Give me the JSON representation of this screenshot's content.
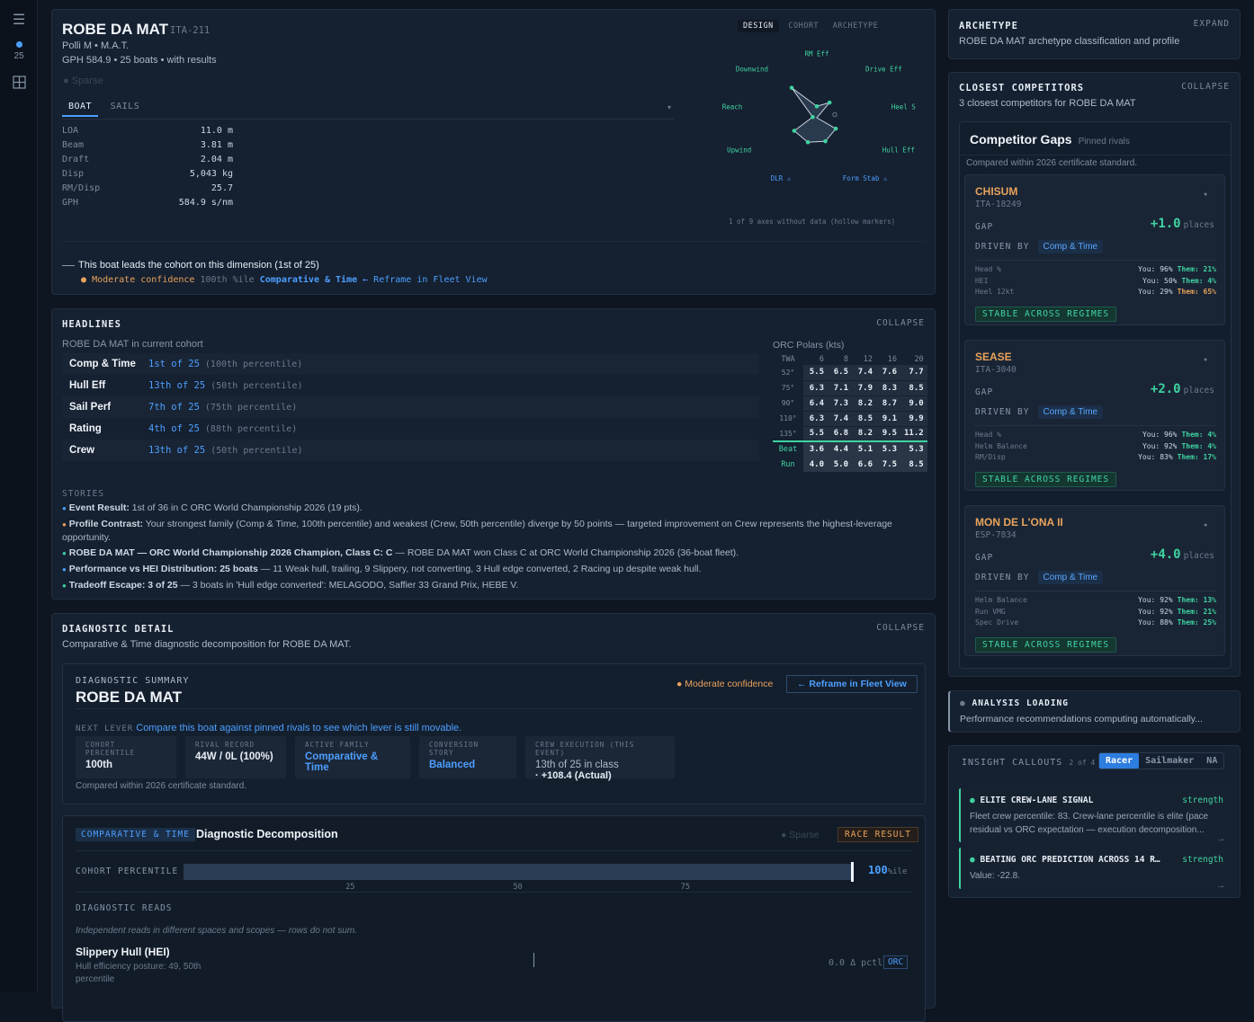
{
  "rail": {
    "menu_icon": "menu-icon",
    "count": "25",
    "grid_icon": "grid-icon"
  },
  "header": {
    "boat_name": "ROBE DA MAT",
    "sail_id": "ITA-211",
    "owner_line": "Polli M • M.A.T.",
    "gph_line": "GPH 584.9 • 25 boats • with results",
    "sparse_label": "Sparse",
    "tabs": [
      "BOAT",
      "SAILS"
    ],
    "specs": [
      {
        "label": "LOA",
        "value": "11.0 m"
      },
      {
        "label": "Beam",
        "value": "3.81 m"
      },
      {
        "label": "Draft",
        "value": "2.04 m"
      },
      {
        "label": "Disp",
        "value": "5,043 kg"
      },
      {
        "label": "RM/Disp",
        "value": "25.7"
      },
      {
        "label": "GPH",
        "value": "584.9 s/nm"
      }
    ],
    "view_tabs": [
      "DESIGN",
      "COHORT",
      "ARCHETYPE"
    ],
    "radar_axes": [
      "RM Eff",
      "Drive Eff",
      "Heel Sens",
      "Hull Eff",
      "Form Stab ⚠",
      "DLR ⚠",
      "Upwind",
      "Reach",
      "Downwind"
    ],
    "radar_values": [
      0.22,
      0.38,
      0.0,
      0.42,
      0.48,
      0.5,
      0.5,
      0.08,
      0.75
    ],
    "radar_note": "1 of 9 axes without data (hollow markers)",
    "lead_text": "This boat leads the cohort on this dimension (1st of 25)",
    "confidence": "Moderate confidence",
    "pctile": "100th %ile",
    "family": "Comparative & Time",
    "reframe": "← Reframe in Fleet View"
  },
  "headlines": {
    "title": "HEADLINES",
    "action": "COLLAPSE",
    "subtitle": "ROBE DA MAT in current cohort",
    "rows": [
      {
        "label": "Comp & Time",
        "rank": "1st of 25",
        "pct": "(100th percentile)"
      },
      {
        "label": "Hull Eff",
        "rank": "13th of 25",
        "pct": "(50th percentile)"
      },
      {
        "label": "Sail Perf",
        "rank": "7th of 25",
        "pct": "(75th percentile)"
      },
      {
        "label": "Rating",
        "rank": "4th of 25",
        "pct": "(88th percentile)"
      },
      {
        "label": "Crew",
        "rank": "13th of 25",
        "pct": "(50th percentile)"
      }
    ],
    "polars_title": "ORC Polars (kts)",
    "polars_head": [
      "TWA",
      "6",
      "8",
      "12",
      "16",
      "20"
    ],
    "polars_rows": [
      [
        "52°",
        "5.5",
        "6.5",
        "7.4",
        "7.6",
        "7.7"
      ],
      [
        "75°",
        "6.3",
        "7.1",
        "7.9",
        "8.3",
        "8.5"
      ],
      [
        "90°",
        "6.4",
        "7.3",
        "8.2",
        "8.7",
        "9.0"
      ],
      [
        "110°",
        "6.3",
        "7.4",
        "8.5",
        "9.1",
        "9.9"
      ],
      [
        "135°",
        "5.5",
        "6.8",
        "8.2",
        "9.5",
        "11.2"
      ]
    ],
    "polars_extra": [
      [
        "Beat",
        "3.6",
        "4.4",
        "5.1",
        "5.3",
        "5.3"
      ],
      [
        "Run",
        "4.0",
        "5.0",
        "6.6",
        "7.5",
        "8.5"
      ]
    ],
    "stories_title": "STORIES",
    "stories": [
      {
        "dot": "#4d9fff",
        "bold": "Event Result:",
        "text": " 1st of 36 in C ORC World Championship 2026 (19 pts)."
      },
      {
        "dot": "#e9a25b",
        "bold": "Profile Contrast:",
        "text": " Your strongest family (Comp & Time, 100th percentile) and weakest (Crew, 50th percentile) diverge by 50 points — targeted improvement on Crew represents the highest-leverage opportunity."
      },
      {
        "dot": "#3fd3a0",
        "bold": "ROBE DA MAT — ORC World Championship 2026 Champion, Class C: C",
        "text": " — ROBE DA MAT won Class C at ORC World Championship 2026 (36-boat fleet)."
      },
      {
        "dot": "#4d9fff",
        "bold": "Performance vs HEI Distribution: 25 boats",
        "text": " — 11 Weak hull, trailing, 9 Slippery, not converting, 3 Hull edge converted, 2 Racing up despite weak hull."
      },
      {
        "dot": "#3fd3a0",
        "bold": "Tradeoff Escape: 3 of 25",
        "text": " — 3 boats in 'Hull edge converted': MELAGODO, Saffier 33 Grand Prix, HEBE V."
      }
    ]
  },
  "diagnostic": {
    "title": "DIAGNOSTIC DETAIL",
    "action": "COLLAPSE",
    "subtitle": "Comparative & Time diagnostic decomposition for ROBE DA MAT.",
    "summary_label": "DIAGNOSTIC SUMMARY",
    "boat": "ROBE DA MAT",
    "confidence": "Moderate confidence",
    "reframe": "← Reframe in Fleet View",
    "next_lever_label": "NEXT LEVER",
    "next_lever": "Compare this boat against pinned rivals to see which lever is still movable.",
    "stats": [
      {
        "label": "COHORT PERCENTILE",
        "value": "100th",
        "color": "#e6edf5"
      },
      {
        "label": "RIVAL RECORD",
        "value": "44W / 0L (100%)",
        "color": "#e6edf5"
      },
      {
        "label": "ACTIVE FAMILY",
        "value": "Comparative & Time",
        "color": "#4d9fff"
      },
      {
        "label": "CONVERSION STORY",
        "value": "Balanced",
        "color": "#4d9fff"
      },
      {
        "label": "CREW EXECUTION (THIS EVENT)",
        "value": "13th of 25 in class",
        "value2": "· +108.4 (Actual)",
        "color": "#aeb9c6"
      }
    ],
    "standard_note": "Compared within 2026 certificate standard.",
    "decomp_tag": "COMPARATIVE & TIME",
    "decomp_title": "Diagnostic Decomposition",
    "sparse": "Sparse",
    "race_result": "RACE RESULT",
    "cohort_label": "COHORT PERCENTILE",
    "cohort_value": 100,
    "cohort_value_text": "100",
    "cohort_unit": "%ile",
    "ticks": [
      "25",
      "50",
      "75"
    ],
    "reads_title": "DIAGNOSTIC READS",
    "reads_note": "Independent reads in different spaces and scopes — rows do not sum.",
    "read_name": "Slippery Hull (HEI)",
    "read_desc": "Hull efficiency posture: 49, 50th percentile",
    "read_value": "0.0 Δ pctl",
    "read_tag": "ORC"
  },
  "archetype": {
    "title": "ARCHETYPE",
    "action": "EXPAND",
    "subtitle": "ROBE DA MAT archetype classification and profile"
  },
  "competitors": {
    "title": "CLOSEST COMPETITORS",
    "action": "COLLAPSE",
    "subtitle": "3 closest competitors for ROBE DA MAT",
    "gaps_title": "Competitor Gaps",
    "gaps_pinned": "Pinned rivals",
    "gaps_note": "Compared within 2026 certificate standard.",
    "gap_label": "GAP",
    "driven_label": "DRIVEN BY",
    "places": "places",
    "stable": "STABLE ACROSS REGIMES",
    "rivals": [
      {
        "name": "CHISUM",
        "sail": "ITA-18249",
        "gap": "+1.0",
        "driver": "Comp & Time",
        "metrics": [
          {
            "k": "Head %",
            "you": "You: 96%",
            "them": "Them: 21%",
            "tc": "#3fd3a0"
          },
          {
            "k": "HEI",
            "you": "You: 50%",
            "them": "Them: 4%",
            "tc": "#3fd3a0"
          },
          {
            "k": "Heel 12kt",
            "you": "You: 29%",
            "them": "Them: 65%",
            "tc": "#e9a25b"
          }
        ]
      },
      {
        "name": "SEASE",
        "sail": "ITA-3040",
        "gap": "+2.0",
        "driver": "Comp & Time",
        "metrics": [
          {
            "k": "Head %",
            "you": "You: 96%",
            "them": "Them: 4%",
            "tc": "#3fd3a0"
          },
          {
            "k": "Helm Balance",
            "you": "You: 92%",
            "them": "Them: 4%",
            "tc": "#3fd3a0"
          },
          {
            "k": "RM/Disp",
            "you": "You: 83%",
            "them": "Them: 17%",
            "tc": "#3fd3a0"
          }
        ]
      },
      {
        "name": "MON DE L'ONA II",
        "sail": "ESP-7834",
        "gap": "+4.0",
        "driver": "Comp & Time",
        "metrics": [
          {
            "k": "Helm Balance",
            "you": "You: 92%",
            "them": "Them: 13%",
            "tc": "#3fd3a0"
          },
          {
            "k": "Run VMG",
            "you": "You: 92%",
            "them": "Them: 21%",
            "tc": "#3fd3a0"
          },
          {
            "k": "Spec Drive",
            "you": "You: 88%",
            "them": "Them: 25%",
            "tc": "#3fd3a0"
          }
        ]
      }
    ]
  },
  "analysis": {
    "title": "ANALYSIS LOADING",
    "text": "Performance recommendations computing automatically..."
  },
  "insights": {
    "title": "INSIGHT CALLOUTS",
    "count": "2 of 4",
    "modes": [
      "Racer",
      "Sailmaker",
      "NA"
    ],
    "items": [
      {
        "title": "ELITE CREW-LANE SIGNAL",
        "kind": "strength",
        "text": "Fleet crew percentile: 83. Crew-lane percentile is elite (pace residual vs ORC expectation — execution decomposition..."
      },
      {
        "title": "BEATING ORC PREDICTION ACROSS 14 R…",
        "kind": "strength",
        "text": "Value: -22.8."
      }
    ]
  },
  "colors": {
    "accent": "#4d9fff",
    "positive": "#3fd3a0",
    "warning": "#e9a25b",
    "background": "#0e1621",
    "panel": "#152030"
  }
}
